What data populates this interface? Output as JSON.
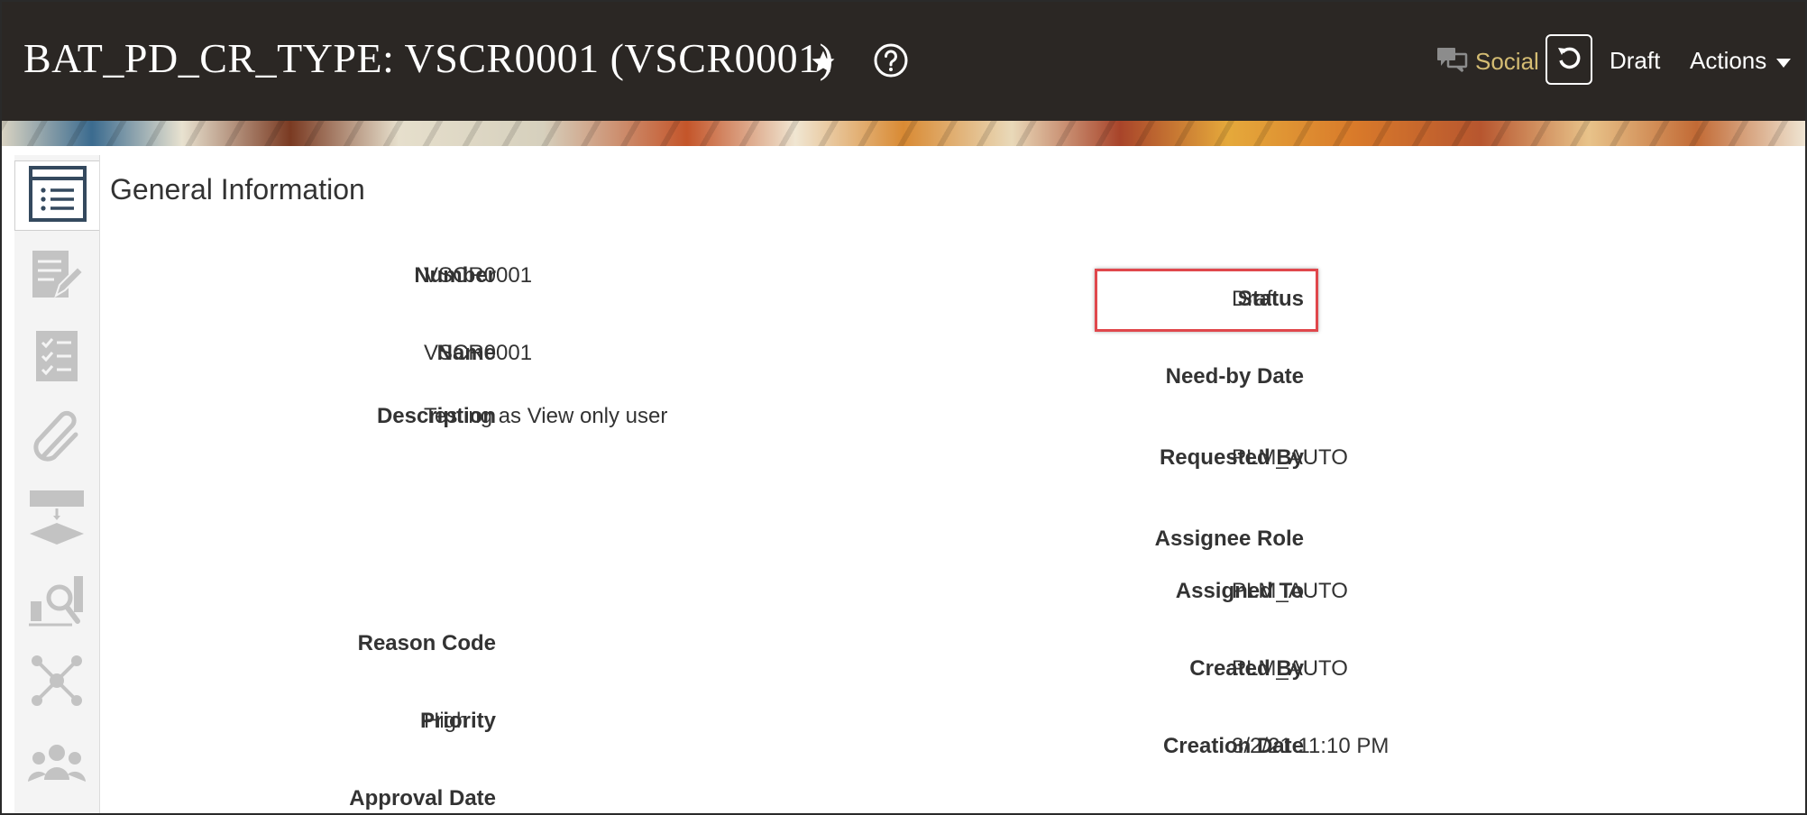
{
  "header": {
    "title": "BAT_PD_CR_TYPE: VSCR0001 (VSCR0001)",
    "favorite_icon": "star-icon",
    "help_icon": "help-icon",
    "social_label": "Social",
    "social_icon": "chat-bubbles-icon",
    "refresh_icon": "refresh-icon",
    "status_label": "Draft",
    "actions_label": "Actions",
    "colors": {
      "background": "#2b2724",
      "social": "#d4bc73",
      "text": "#ffffff"
    }
  },
  "side_nav": {
    "items": [
      {
        "icon": "general-information-icon",
        "active": true
      },
      {
        "icon": "edit-document-icon"
      },
      {
        "icon": "checklist-icon"
      },
      {
        "icon": "attachment-icon"
      },
      {
        "icon": "workflow-icon"
      },
      {
        "icon": "impact-analysis-icon"
      },
      {
        "icon": "relationships-icon"
      },
      {
        "icon": "team-icon"
      }
    ]
  },
  "general_information": {
    "section_title": "General Information",
    "left_fields": [
      {
        "label": "Number",
        "value": "VSCR0001"
      },
      {
        "label": "Name",
        "value": "VSCR0001"
      },
      {
        "label": "Description",
        "value": "Testing as View only user"
      },
      {
        "label": "Reason Code",
        "value": ""
      },
      {
        "label": "Priority",
        "value": "High"
      },
      {
        "label": "Approval Date",
        "value": ""
      }
    ],
    "right_fields": [
      {
        "label": "Status",
        "value": "Draft"
      },
      {
        "label": "Need-by Date",
        "value": ""
      },
      {
        "label": "Requested By",
        "value": "PLM_AUTO"
      },
      {
        "label": "Assignee Role",
        "value": ""
      },
      {
        "label": "Assigned To",
        "value": "PLM_AUTO"
      },
      {
        "label": "Created By",
        "value": "PLM_AUTO"
      },
      {
        "label": "Creation Date",
        "value": "3/2/21 11:10 PM"
      }
    ],
    "highlight_color": "#e0474c"
  }
}
